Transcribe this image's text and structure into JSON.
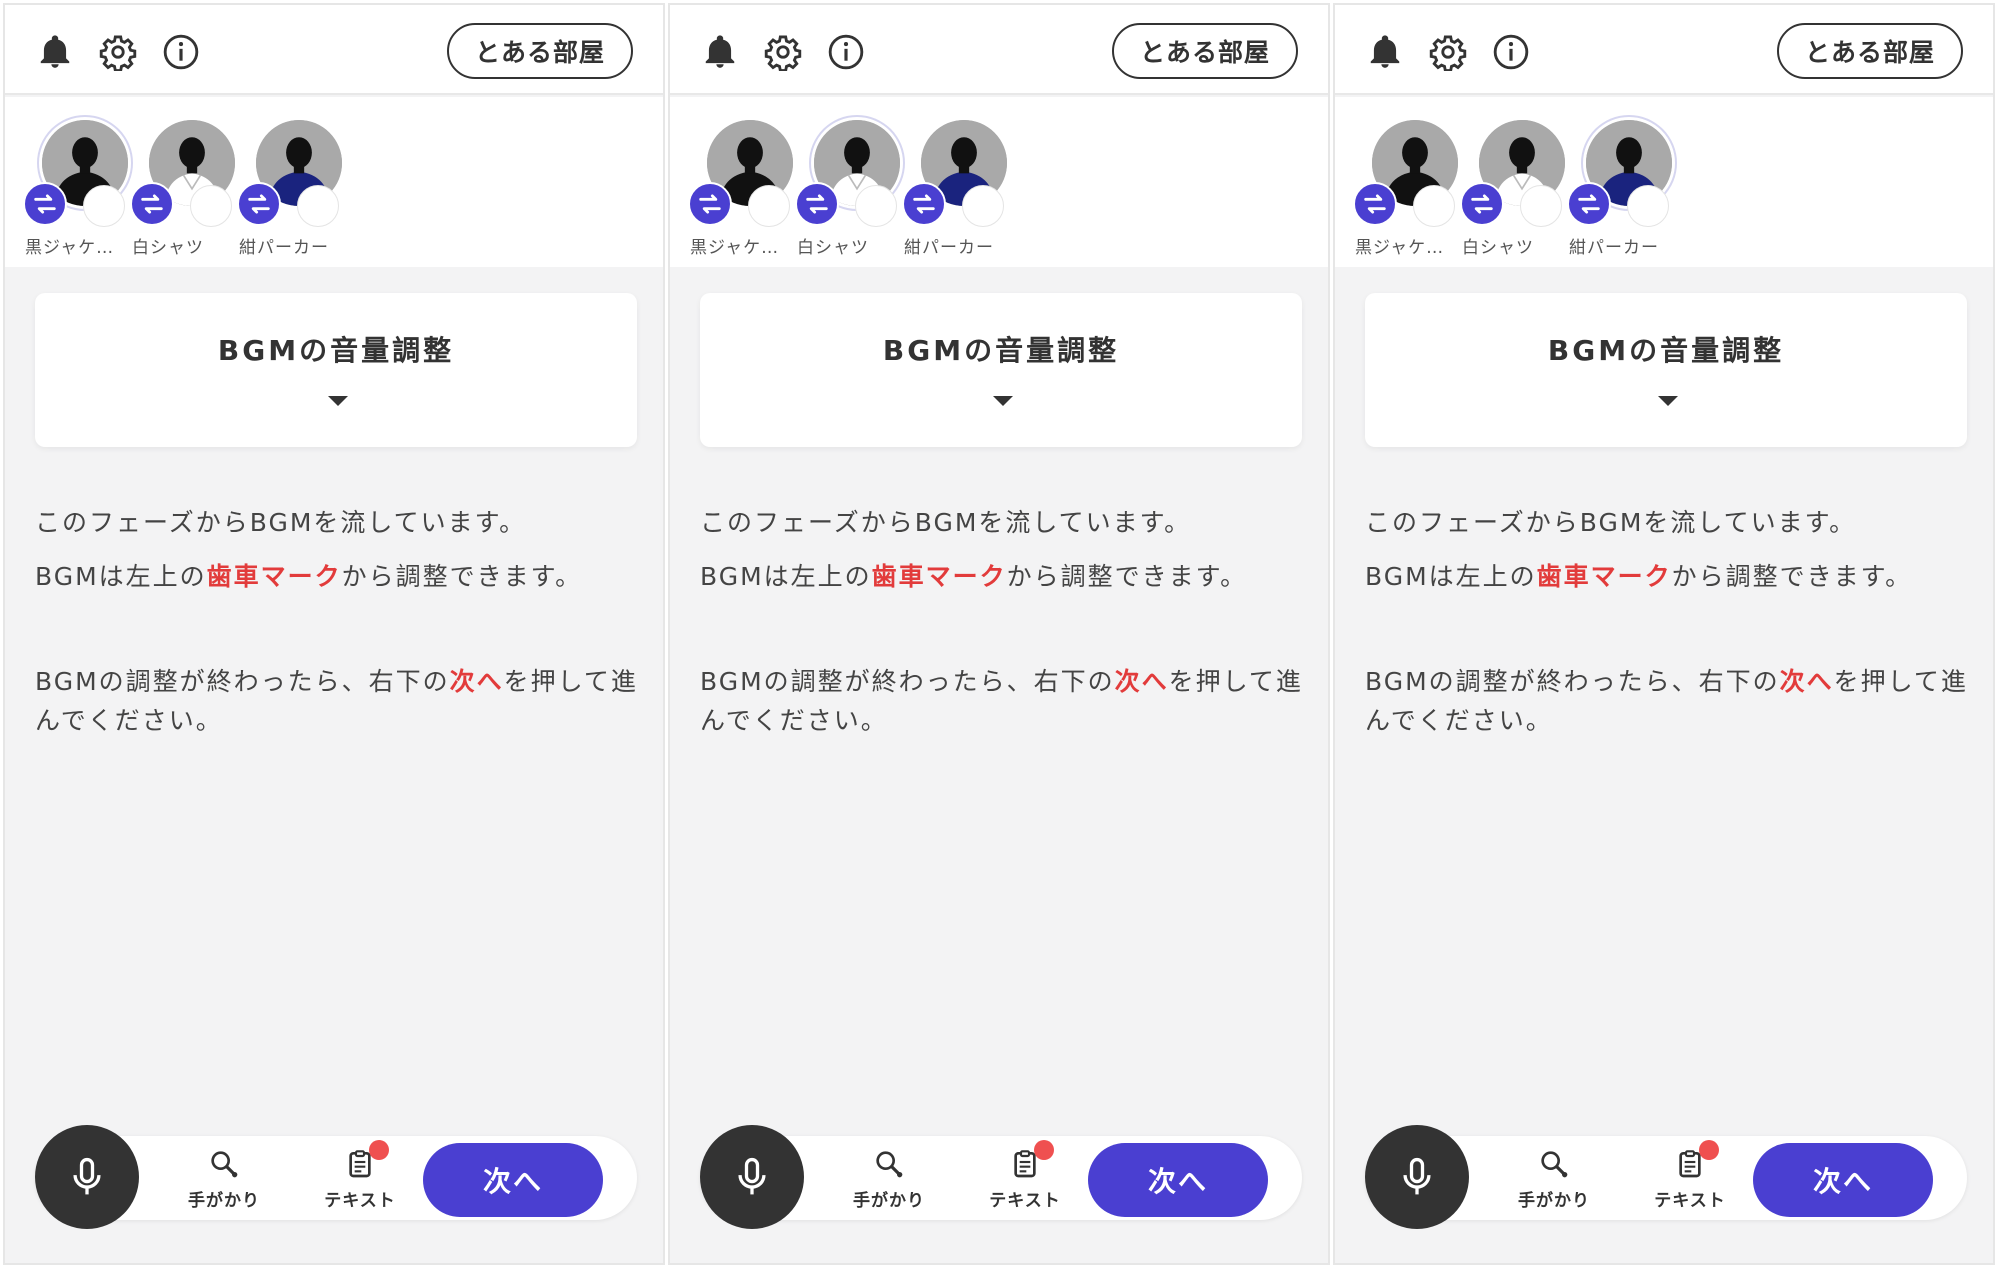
{
  "panels": [
    {
      "room_button": "とある部屋",
      "characters": [
        {
          "name": "黒ジャケ…",
          "outfit_color": "#111111",
          "selected": true
        },
        {
          "name": "白シャツ",
          "outfit_color": "#ffffff",
          "selected": false
        },
        {
          "name": "紺パーカー",
          "outfit_color": "#1a237e",
          "selected": false
        }
      ],
      "bgm_card_title": "BGMの音量調整",
      "text1": "このフェーズからBGMを流しています。",
      "text2_pre": "BGMは左上の",
      "text2_hl": "歯車マーク",
      "text2_post": "から調整できます。",
      "text3_pre": "BGMの調整が終わったら、右下の",
      "text3_hl": "次へ",
      "text3_post": "を押して進んでください。",
      "clue_label": "手がかり",
      "text_label": "テキスト",
      "next_label": "次へ"
    },
    {
      "room_button": "とある部屋",
      "characters": [
        {
          "name": "黒ジャケ…",
          "outfit_color": "#111111",
          "selected": false
        },
        {
          "name": "白シャツ",
          "outfit_color": "#ffffff",
          "selected": true
        },
        {
          "name": "紺パーカー",
          "outfit_color": "#1a237e",
          "selected": false
        }
      ],
      "bgm_card_title": "BGMの音量調整",
      "text1": "このフェーズからBGMを流しています。",
      "text2_pre": "BGMは左上の",
      "text2_hl": "歯車マーク",
      "text2_post": "から調整できます。",
      "text3_pre": "BGMの調整が終わったら、右下の",
      "text3_hl": "次へ",
      "text3_post": "を押して進んでください。",
      "clue_label": "手がかり",
      "text_label": "テキスト",
      "next_label": "次へ"
    },
    {
      "room_button": "とある部屋",
      "characters": [
        {
          "name": "黒ジャケ…",
          "outfit_color": "#111111",
          "selected": false
        },
        {
          "name": "白シャツ",
          "outfit_color": "#ffffff",
          "selected": false
        },
        {
          "name": "紺パーカー",
          "outfit_color": "#1a237e",
          "selected": true
        }
      ],
      "bgm_card_title": "BGMの音量調整",
      "text1": "このフェーズからBGMを流しています。",
      "text2_pre": "BGMは左上の",
      "text2_hl": "歯車マーク",
      "text2_post": "から調整できます。",
      "text3_pre": "BGMの調整が終わったら、右下の",
      "text3_hl": "次へ",
      "text3_post": "を押して進んでください。",
      "clue_label": "手がかり",
      "text_label": "テキスト",
      "next_label": "次へ"
    }
  ],
  "colors": {
    "accent": "#4a3fd1",
    "highlight": "#e23b3b",
    "badge": "#ef5050",
    "panel_bg": "#f3f3f4"
  }
}
